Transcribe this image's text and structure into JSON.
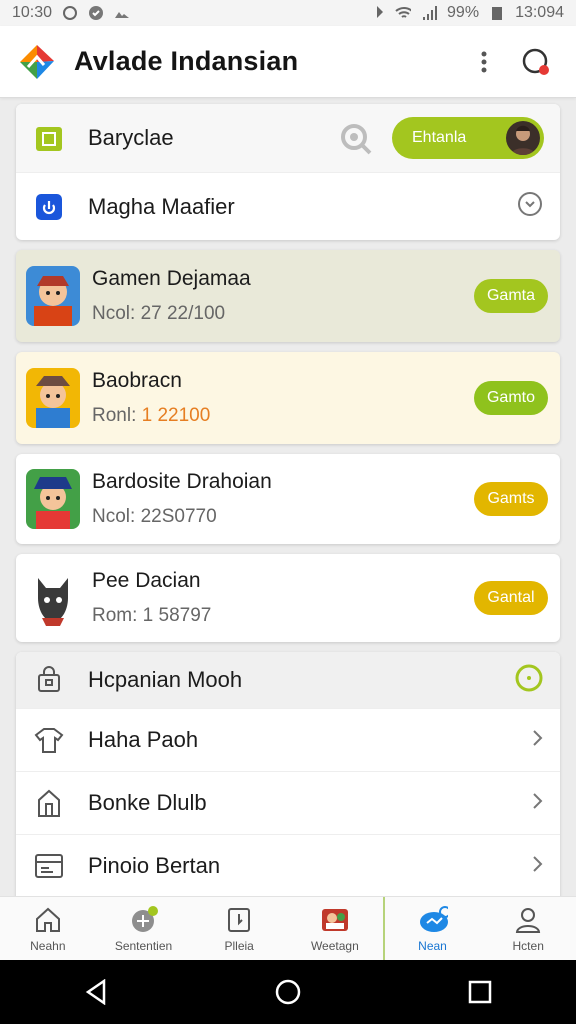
{
  "status_bar": {
    "time_left": "10:30",
    "battery": "99%",
    "time_right": "13:094"
  },
  "app_bar": {
    "title": "Avlade Indansian",
    "more_icon": "more-vert-icon",
    "notify_icon": "notification-icon"
  },
  "top_card": {
    "rows": [
      {
        "label": "Baryclae",
        "icon": "clipboard-icon",
        "pill_label": "Ehtanla"
      },
      {
        "label": "Magha Maafier",
        "icon": "app-blue-icon"
      }
    ]
  },
  "games": [
    {
      "name": "Gamen Dejamaa",
      "sub": "Ncol: 27 22/100",
      "button": "Gamta",
      "btn_color": "#a3c61f"
    },
    {
      "name": "Baobracn",
      "sub_prefix": "Ronl: ",
      "sub_value": "1 22100",
      "button": "Gamto",
      "btn_color": "#8fc21d"
    },
    {
      "name": "Bardosite Drahoian",
      "sub": "Ncol: 22S0770",
      "button": "Gamts",
      "btn_color": "#e2b600"
    },
    {
      "name": "Pee Dacian",
      "sub": "Rom: 1 58797",
      "button": "Gantal",
      "btn_color": "#e2b600"
    }
  ],
  "settings": {
    "header": "Hcpanian Mooh",
    "items": [
      {
        "label": "Haha Paoh",
        "icon": "shirt-icon"
      },
      {
        "label": "Bonke Dlulb",
        "icon": "building-icon"
      },
      {
        "label": "Pinoio Bertan",
        "icon": "form-icon"
      }
    ]
  },
  "bottom_nav": [
    {
      "label": "Neahn",
      "icon": "home-icon"
    },
    {
      "label": "Sententien",
      "icon": "settings-icon"
    },
    {
      "label": "Plleia",
      "icon": "document-icon"
    },
    {
      "label": "Weetagn",
      "icon": "profile-photo-icon"
    },
    {
      "label": "Nean",
      "icon": "cloud-share-icon",
      "active": true
    },
    {
      "label": "Hcten",
      "icon": "user-icon"
    }
  ],
  "colors": {
    "accent_green": "#a3c61f",
    "accent_yellow": "#e2b600",
    "active_blue": "#1976d2"
  }
}
